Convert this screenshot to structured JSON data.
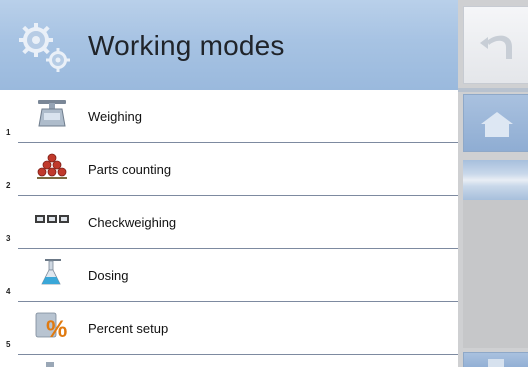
{
  "header": {
    "title": "Working modes",
    "icon": "gears-icon"
  },
  "modes": [
    {
      "number": "1",
      "label": "Weighing",
      "icon": "scale-icon"
    },
    {
      "number": "2",
      "label": "Parts counting",
      "icon": "parts-stack-icon"
    },
    {
      "number": "3",
      "label": "Checkweighing",
      "icon": "checkweighing-icon"
    },
    {
      "number": "4",
      "label": "Dosing",
      "icon": "flask-icon"
    },
    {
      "number": "5",
      "label": "Percent setup",
      "icon": "percent-icon"
    }
  ],
  "toolbar": {
    "back_icon": "back-arrow-icon",
    "home_icon": "home-icon",
    "scroll_down_icon": "scroll-down-icon"
  },
  "colors": {
    "header_background": "#a7c3e3",
    "sidebar_background": "#cfd0d2",
    "row_separator": "#7d8aa0"
  }
}
